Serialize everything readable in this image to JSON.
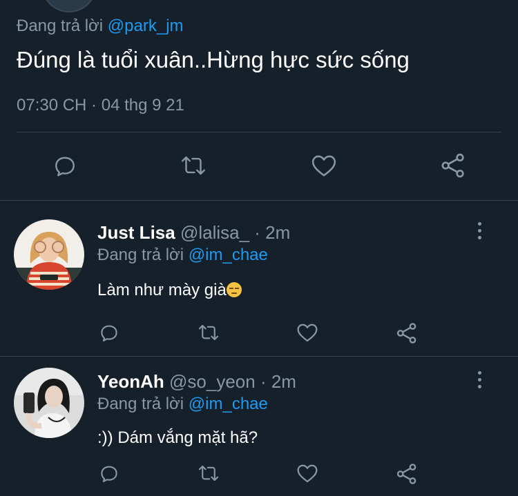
{
  "main_tweet": {
    "replying_prefix": "Đang trả lời",
    "replying_handle": "@park_jm",
    "text": "Đúng là tuổi xuân..Hừng hực sức sống",
    "timestamp": "07:30 CH · 04 thg 9 21",
    "actions": [
      "reply-icon",
      "retweet-icon",
      "like-icon",
      "share-icon"
    ]
  },
  "replies": [
    {
      "display_name": "Just Lisa",
      "handle": "@lalisa_",
      "time": "· 2m",
      "replying_prefix": "Đang trả lời",
      "replying_handle": "@im_chae",
      "text": "Làm như mày già"
    },
    {
      "display_name": "YeonAh",
      "handle": "@so_yeon",
      "time": "· 2m",
      "replying_prefix": "Đang trả lời",
      "replying_handle": "@im_chae",
      "text": ":)) Dám vắng mặt hã?"
    }
  ],
  "colors": {
    "background": "#15202b",
    "secondary_text": "#8899a6",
    "link": "#1d9bf0",
    "divider": "#38444d"
  }
}
